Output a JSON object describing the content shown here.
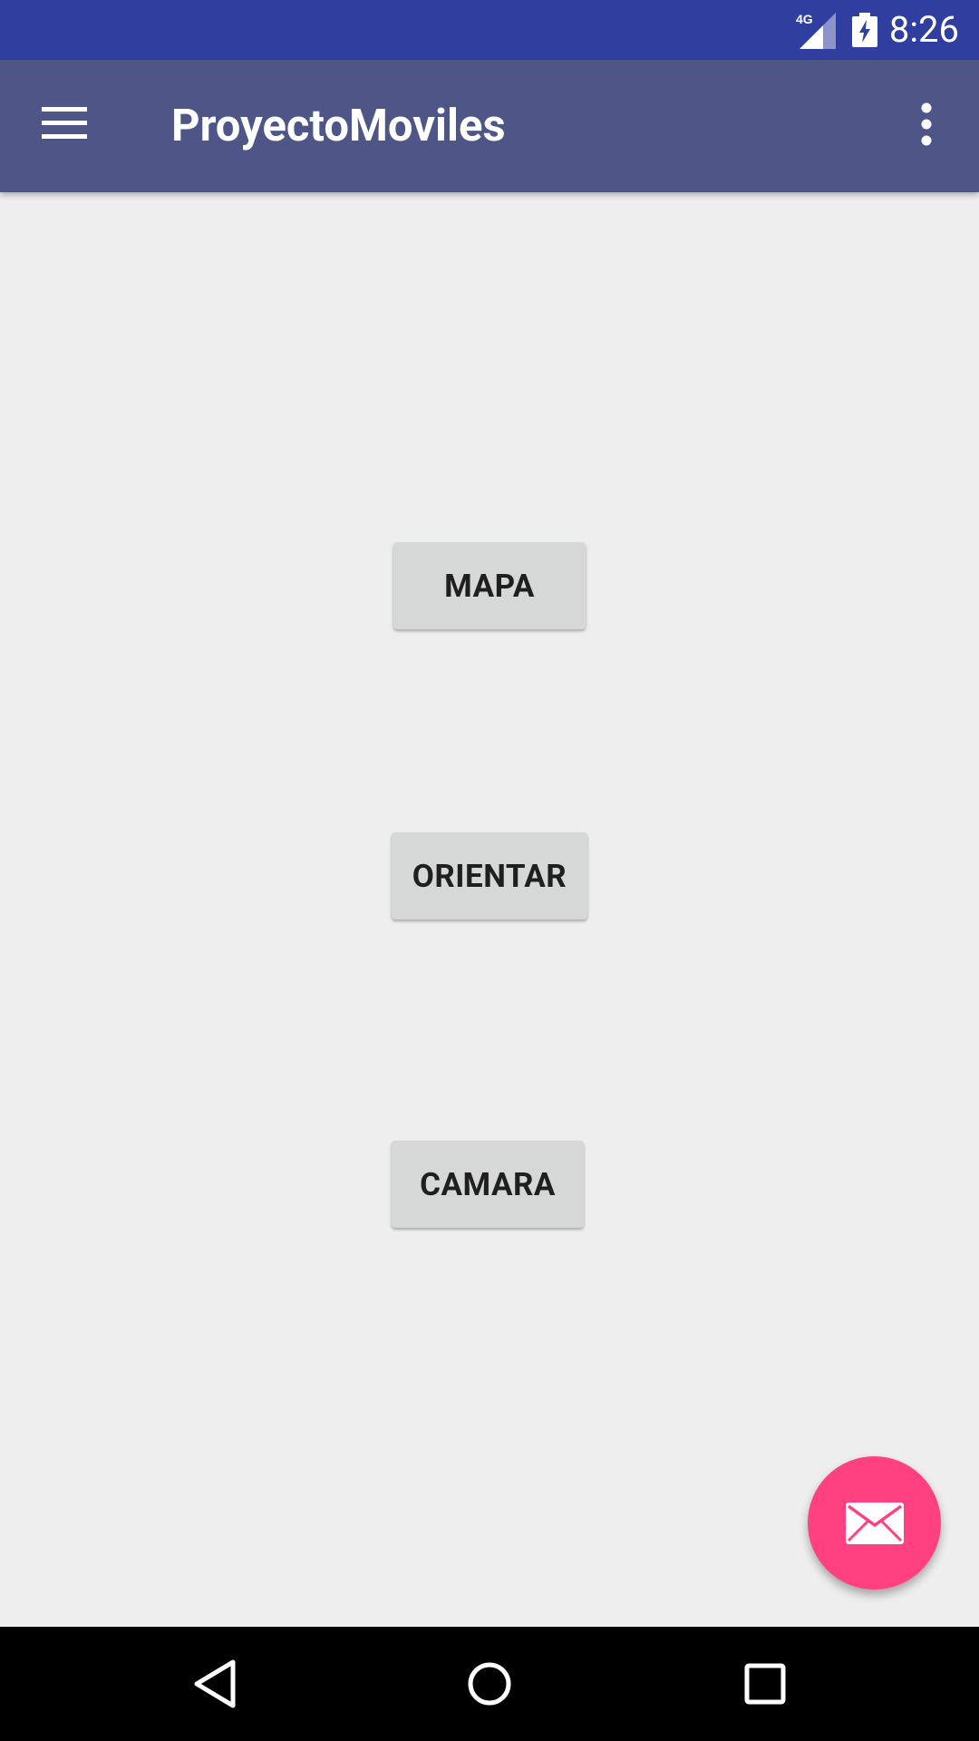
{
  "status_bar": {
    "network": "4G",
    "time": "8:26",
    "signal_icon": "cellular-signal-icon",
    "battery_icon": "battery-charging-icon"
  },
  "app_bar": {
    "title": "ProyectoMoviles",
    "menu_icon": "hamburger-menu-icon",
    "overflow_icon": "more-vert-icon",
    "background": "#4e5587"
  },
  "buttons": [
    {
      "label": "MAPA"
    },
    {
      "label": "ORIENTAR"
    },
    {
      "label": "CAMARA"
    }
  ],
  "fab": {
    "icon": "email-icon",
    "color": "#ff4081"
  },
  "nav_bar": {
    "back_icon": "back-triangle-icon",
    "home_icon": "home-circle-icon",
    "recents_icon": "recents-square-icon"
  },
  "colors": {
    "status_bar": "#303f9f",
    "background": "#eeeeee",
    "button": "#d6d7d7"
  }
}
